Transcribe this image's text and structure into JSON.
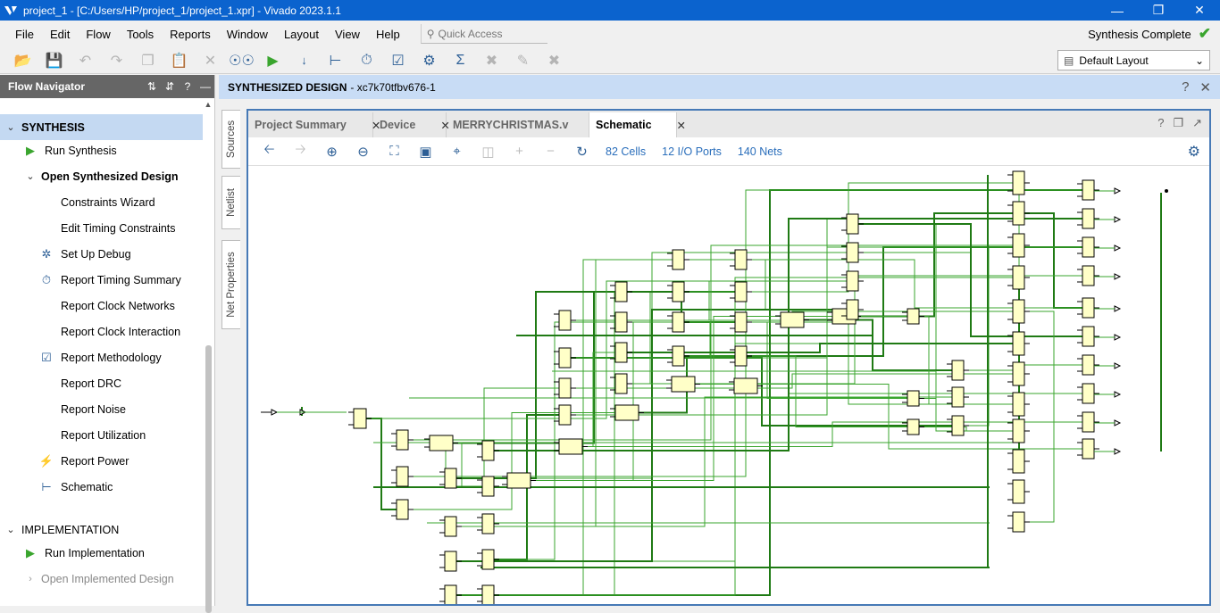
{
  "title_bar": {
    "text": "project_1 - [C:/Users/HP/project_1/project_1.xpr] - Vivado 2023.1.1"
  },
  "menu": [
    "File",
    "Edit",
    "Flow",
    "Tools",
    "Reports",
    "Window",
    "Layout",
    "View",
    "Help"
  ],
  "quick_access": {
    "placeholder": "Quick Access"
  },
  "status": {
    "text": "Synthesis Complete"
  },
  "layout_select": {
    "value": "Default Layout"
  },
  "flow_navigator": {
    "title": "Flow Navigator",
    "synthesis": {
      "label": "SYNTHESIS",
      "run": "Run Synthesis",
      "open": "Open Synthesized Design",
      "children": [
        "Constraints Wizard",
        "Edit Timing Constraints",
        "Set Up Debug",
        "Report Timing Summary",
        "Report Clock Networks",
        "Report Clock Interaction",
        "Report Methodology",
        "Report DRC",
        "Report Noise",
        "Report Utilization",
        "Report Power",
        "Schematic"
      ]
    },
    "implementation": {
      "label": "IMPLEMENTATION",
      "run": "Run Implementation",
      "open": "Open Implemented Design"
    }
  },
  "side_tabs": [
    "Sources",
    "Netlist",
    "Net Properties"
  ],
  "design_header": {
    "label": "SYNTHESIZED DESIGN",
    "part": "- xc7k70tfbv676-1"
  },
  "tabs": [
    "Project Summary",
    "Device",
    "MERRYCHRISTMAS.v",
    "Schematic"
  ],
  "active_tab": "Schematic",
  "schematic": {
    "cells": "82 Cells",
    "io_ports": "12 I/O Ports",
    "nets": "140 Nets"
  },
  "colors": {
    "titlebar": "#0b63ce",
    "accent": "#4679b6",
    "cell": "#ffffc8",
    "wire": "#3aa52e"
  },
  "icons": {
    "synthesis_complete": "check-icon"
  }
}
